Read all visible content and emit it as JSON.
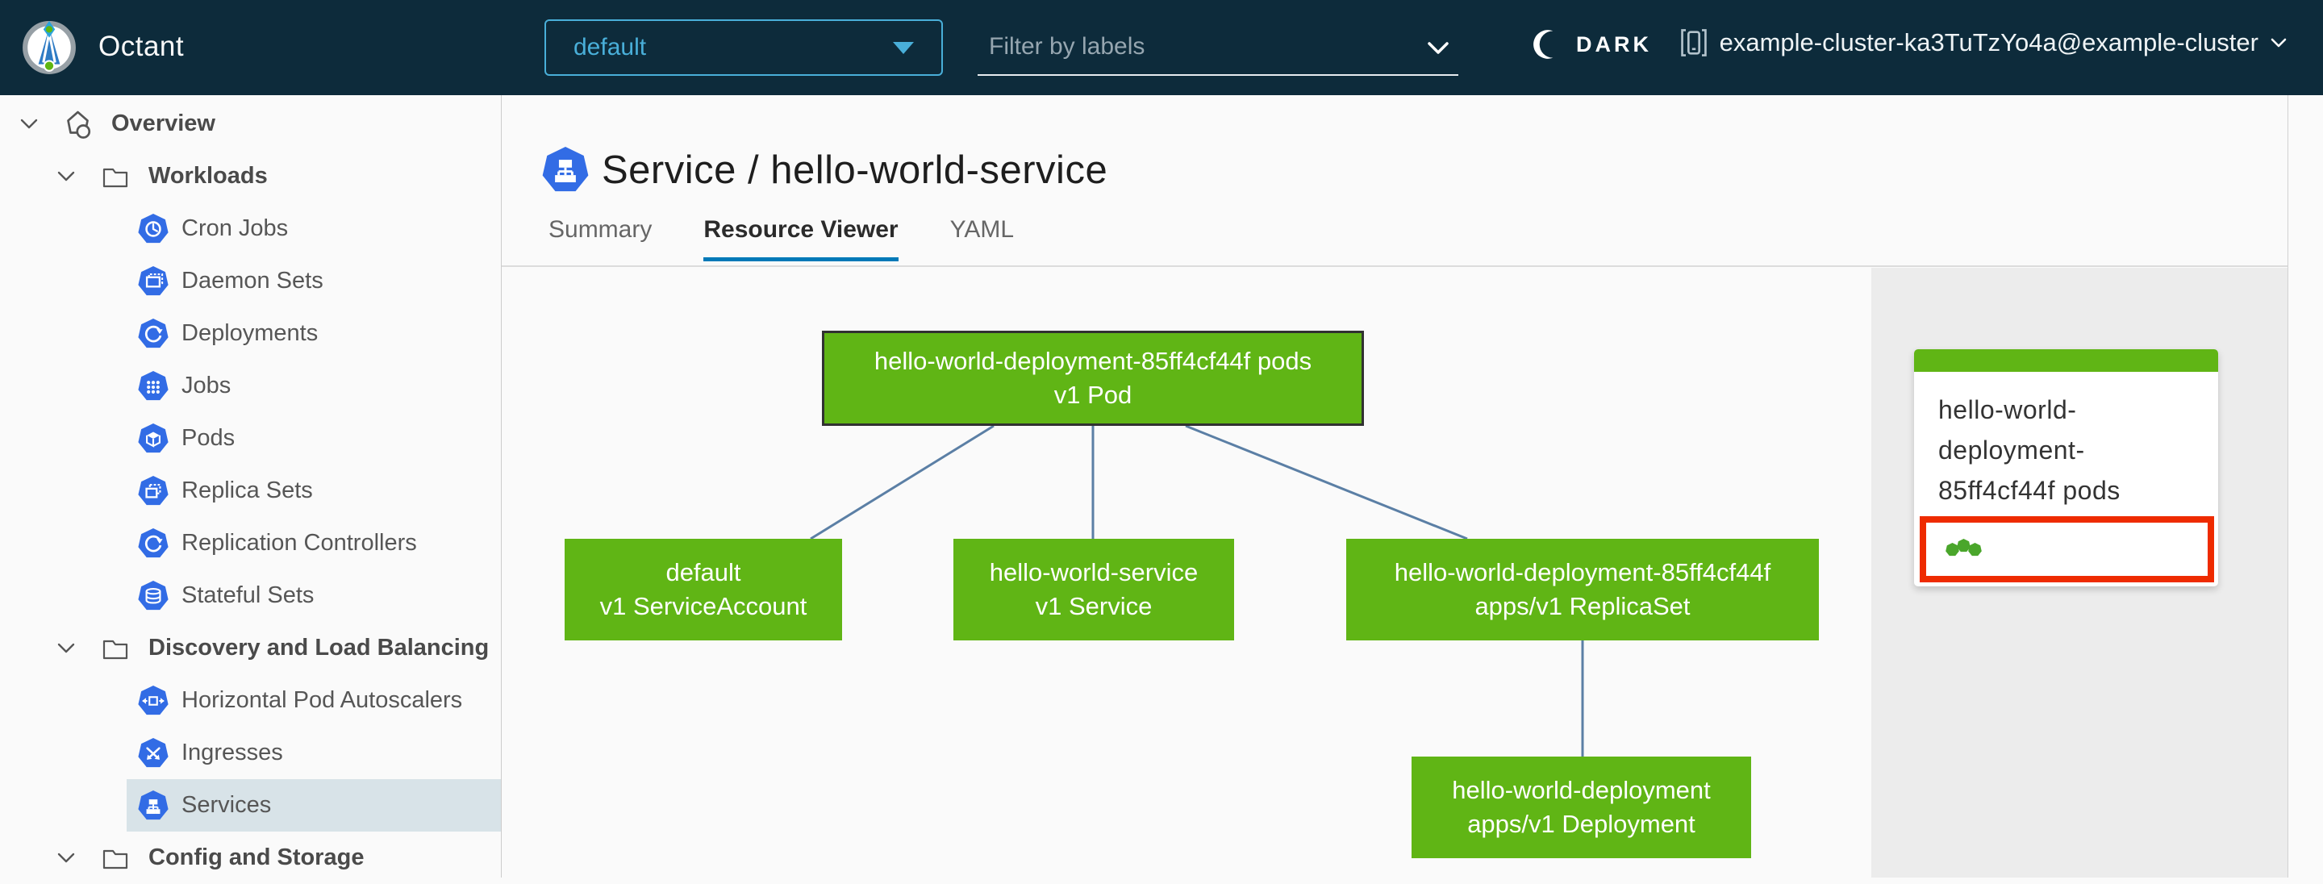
{
  "header": {
    "app_name": "Octant",
    "namespace": "default",
    "filter_placeholder": "Filter by labels",
    "theme_toggle": "DARK",
    "cluster": "example-cluster-ka3TuTzYo4a@example-cluster"
  },
  "sidebar": {
    "items": [
      {
        "label": "Overview",
        "level": "root",
        "expanded": true
      },
      {
        "label": "Workloads",
        "level": "group",
        "expanded": true
      },
      {
        "label": "Cron Jobs",
        "level": "leaf"
      },
      {
        "label": "Daemon Sets",
        "level": "leaf"
      },
      {
        "label": "Deployments",
        "level": "leaf"
      },
      {
        "label": "Jobs",
        "level": "leaf"
      },
      {
        "label": "Pods",
        "level": "leaf"
      },
      {
        "label": "Replica Sets",
        "level": "leaf"
      },
      {
        "label": "Replication Controllers",
        "level": "leaf"
      },
      {
        "label": "Stateful Sets",
        "level": "leaf"
      },
      {
        "label": "Discovery and Load Balancing",
        "level": "group",
        "expanded": true
      },
      {
        "label": "Horizontal Pod Autoscalers",
        "level": "leaf"
      },
      {
        "label": "Ingresses",
        "level": "leaf"
      },
      {
        "label": "Services",
        "level": "leaf",
        "selected": true
      },
      {
        "label": "Config and Storage",
        "level": "group",
        "expanded": true
      }
    ]
  },
  "main": {
    "title": "Service / hello-world-service",
    "tabs": [
      {
        "label": "Summary",
        "active": false
      },
      {
        "label": "Resource Viewer",
        "active": true
      },
      {
        "label": "YAML",
        "active": false
      }
    ]
  },
  "graph": {
    "nodes": [
      {
        "name": "hello-world-deployment-85ff4cf44f pods",
        "kind": "v1 Pod",
        "status": "ok",
        "selected": true
      },
      {
        "name": "default",
        "kind": "v1 ServiceAccount",
        "status": "ok"
      },
      {
        "name": "hello-world-service",
        "kind": "v1 Service",
        "status": "ok"
      },
      {
        "name": "hello-world-deployment-85ff4cf44f",
        "kind": "apps/v1 ReplicaSet",
        "status": "ok"
      },
      {
        "name": "hello-world-deployment",
        "kind": "apps/v1 Deployment",
        "status": "ok"
      }
    ],
    "edges": [
      {
        "from": "hello-world-deployment-85ff4cf44f pods",
        "to": "default"
      },
      {
        "from": "hello-world-deployment-85ff4cf44f pods",
        "to": "hello-world-service"
      },
      {
        "from": "hello-world-deployment-85ff4cf44f pods",
        "to": "hello-world-deployment-85ff4cf44f"
      },
      {
        "from": "hello-world-deployment-85ff4cf44f",
        "to": "hello-world-deployment"
      }
    ]
  },
  "side_panel": {
    "card_title": "hello-world-deployment-85ff4cf44f pods",
    "pod_dot_count": 3
  },
  "colors": {
    "header_bg": "#0d2b3b",
    "accent_blue": "#49afd9",
    "tab_underline": "#0079b8",
    "node_green": "#60b515",
    "edge_blue": "#5b7fa5",
    "selection_red": "#ee2b00",
    "status_dot_green": "#4aa62b",
    "k8s_icon_blue": "#326ce5",
    "sidebar_selected_bg": "#d8e3e8"
  }
}
